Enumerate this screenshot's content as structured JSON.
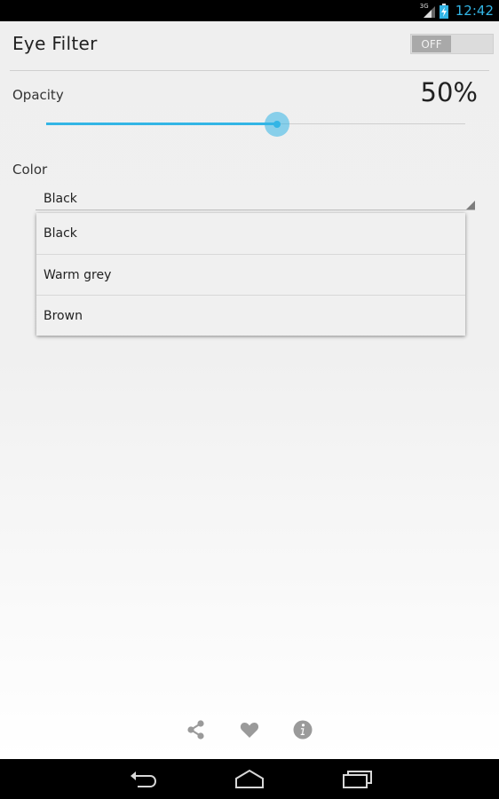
{
  "status_bar": {
    "network": "3G",
    "time": "12:42"
  },
  "header": {
    "title": "Eye Filter",
    "toggle_label": "OFF"
  },
  "opacity": {
    "label": "Opacity",
    "value_text": "50%",
    "value_fraction": 0.55
  },
  "color": {
    "label": "Color",
    "selected": "Black",
    "options": [
      "Black",
      "Warm grey",
      "Brown"
    ]
  },
  "bottom_actions": [
    "share-icon",
    "heart-icon",
    "info-icon"
  ],
  "nav_bar": [
    "back-icon",
    "home-icon",
    "recent-apps-icon"
  ],
  "colors": {
    "accent": "#33b5e5",
    "toggle_off": "#a9a9a9"
  }
}
